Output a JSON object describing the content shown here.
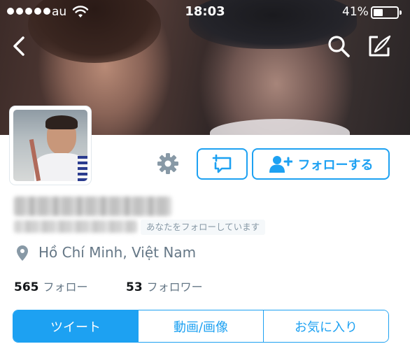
{
  "status_bar": {
    "carrier": "au",
    "time": "18:03",
    "battery_percent": "41%",
    "battery_level": 0.41,
    "icons": [
      "signal-dots-icon",
      "wifi-icon",
      "battery-icon"
    ]
  },
  "header": {
    "icons": [
      "back-icon",
      "search-icon",
      "compose-icon"
    ]
  },
  "profile": {
    "follows_you_badge": "あなたをフォローしています",
    "location": "Hồ Chí Minh, Việt Nam",
    "stats": {
      "following_count": "565",
      "following_label": "フォロー",
      "followers_count": "53",
      "followers_label": "フォロワー"
    }
  },
  "actions": {
    "follow_label": "フォローする",
    "icons": [
      "gear-icon",
      "direct-message-icon",
      "add-user-icon"
    ]
  },
  "tabs": [
    {
      "label": "ツイート",
      "active": true
    },
    {
      "label": "動画/画像",
      "active": false
    },
    {
      "label": "お気に入り",
      "active": false
    }
  ],
  "colors": {
    "accent": "#1da1f2",
    "muted_text": "#657786",
    "badge_background": "#f5f8fa"
  }
}
